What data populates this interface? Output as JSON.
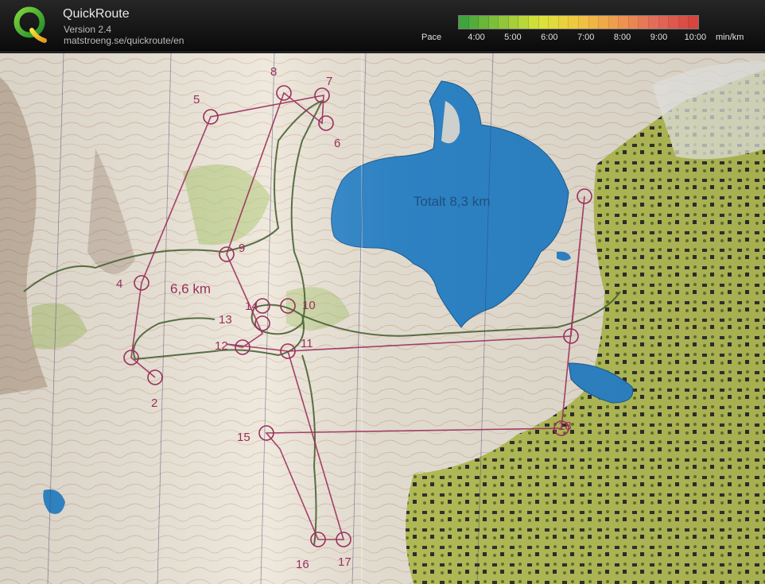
{
  "app": {
    "title": "QuickRoute",
    "version": "Version 2.4",
    "url": "matstroeng.se/quickroute/en"
  },
  "pace_legend": {
    "label": "Pace",
    "ticks": [
      "4:00",
      "5:00",
      "6:00",
      "7:00",
      "8:00",
      "9:00",
      "10:00"
    ],
    "unit": "min/km",
    "colors": [
      "#3fa43c",
      "#8fc63a",
      "#dbe43a",
      "#f2c641",
      "#ef9a4e",
      "#e46b5a",
      "#d8443f"
    ]
  },
  "map": {
    "course_labels": {
      "total": "Totalt 8,3 km",
      "short": "6,6 km"
    },
    "controls": [
      "2",
      "4",
      "5",
      "6",
      "7",
      "8",
      "9",
      "10",
      "11",
      "12",
      "13",
      "14",
      "15",
      "16",
      "17",
      "18"
    ],
    "colors": {
      "paper": "#ece5d9",
      "water": "#2f88cc",
      "green": "#b9c65a",
      "contour": "#b2733f",
      "course": "#9a2f5c",
      "route": "#3f5a2a"
    }
  }
}
